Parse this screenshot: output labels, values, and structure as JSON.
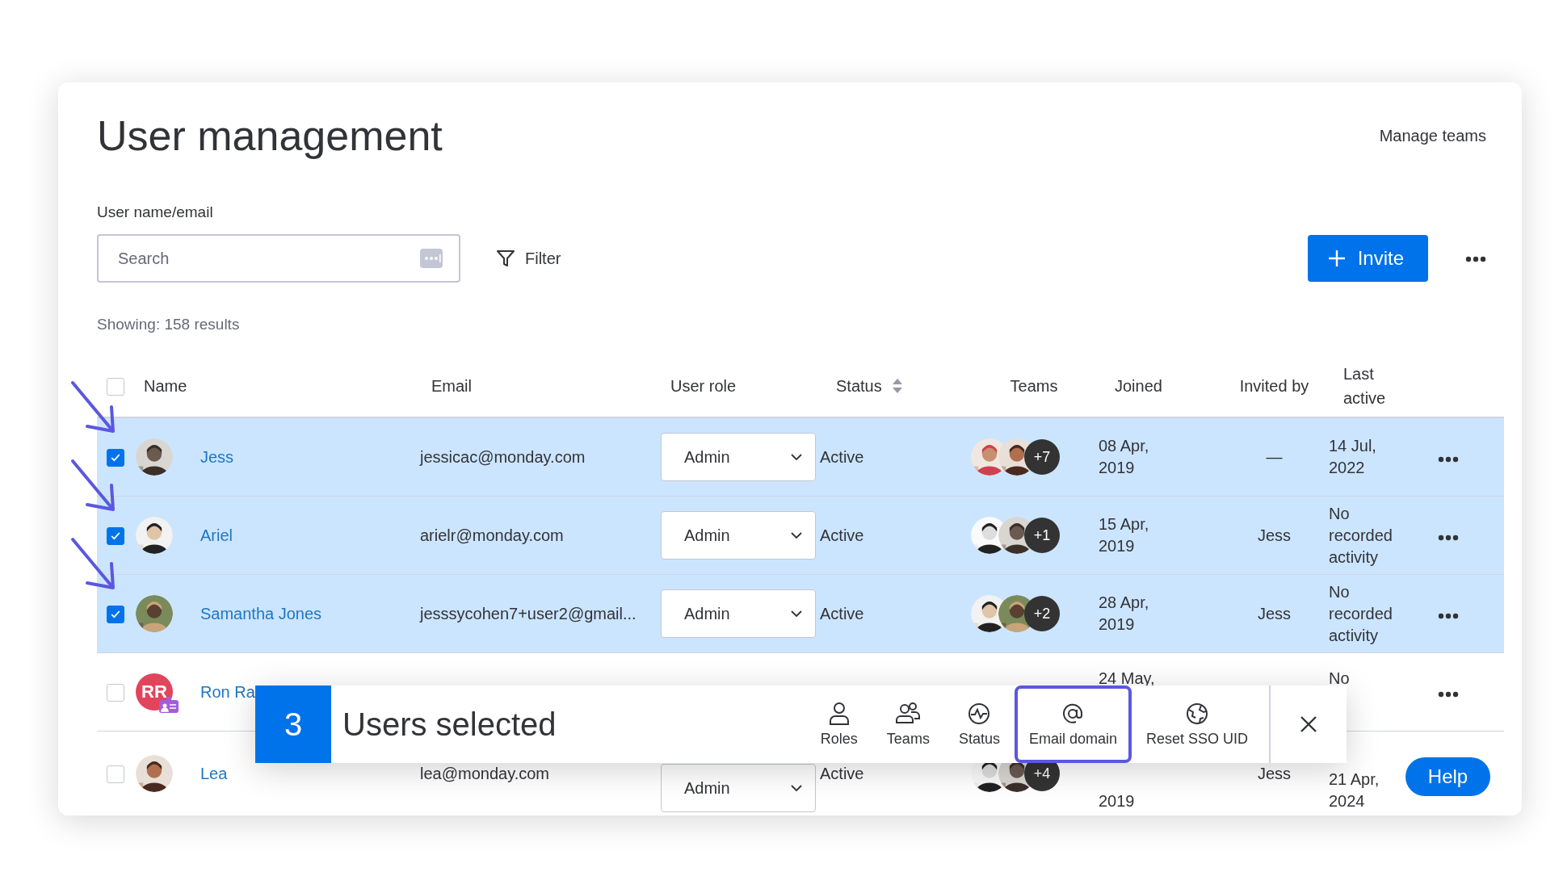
{
  "title": "User management",
  "manage_teams": "Manage teams",
  "search": {
    "label": "User name/email",
    "placeholder": "Search"
  },
  "filter": "Filter",
  "invite": "Invite",
  "results": "Showing: 158 results",
  "header_checked": false,
  "columns": [
    "Name",
    "Email",
    "User role",
    "Status",
    "Teams",
    "Joined",
    "Invited by",
    "Last active"
  ],
  "rows": [
    {
      "kind": "full",
      "name": "Jess",
      "email": "jessicac@monday.com",
      "role": "Admin",
      "status": "Active",
      "teams_more": "+7",
      "joined": "08 Apr, 2019",
      "invited_by": "—",
      "last_active": "14 Jul, 2022",
      "selected": true,
      "arrow": true
    },
    {
      "kind": "full",
      "name": "Ariel",
      "email": "arielr@monday.com",
      "role": "Admin",
      "status": "Active",
      "teams_more": "+1",
      "joined": "15 Apr, 2019",
      "invited_by": "Jess",
      "last_active": "No recorded activity",
      "selected": true,
      "arrow": true
    },
    {
      "kind": "full",
      "name": "Samantha Jones",
      "email": "jesssycohen7+user2@gmail...",
      "role": "Admin",
      "status": "Active",
      "teams_more": "+2",
      "joined": "28 Apr, 2019",
      "invited_by": "Jess",
      "last_active": "No recorded activity",
      "selected": true,
      "arrow": true
    },
    {
      "kind": "covered",
      "name": "Ron Ra",
      "initials": "RR",
      "joined": "24 May,",
      "last_active": "No",
      "selected": false,
      "arrow": false
    },
    {
      "kind": "lower",
      "name": "Lea",
      "email": "lea@monday.com",
      "role": "Admin",
      "status": "Active",
      "teams_more": "+4",
      "joined": "2019",
      "invited_by": "Jess",
      "last_active": "21 Apr, 2024",
      "selected": false,
      "arrow": false
    }
  ],
  "toolbar": {
    "count": "3",
    "label": "Users selected",
    "actions": [
      {
        "label": "Roles",
        "highlighted": false
      },
      {
        "label": "Teams",
        "highlighted": false
      },
      {
        "label": "Status",
        "highlighted": false
      },
      {
        "label": "Email domain",
        "highlighted": true
      },
      {
        "label": "Reset SSO UID",
        "highlighted": false
      }
    ]
  },
  "help": "Help"
}
